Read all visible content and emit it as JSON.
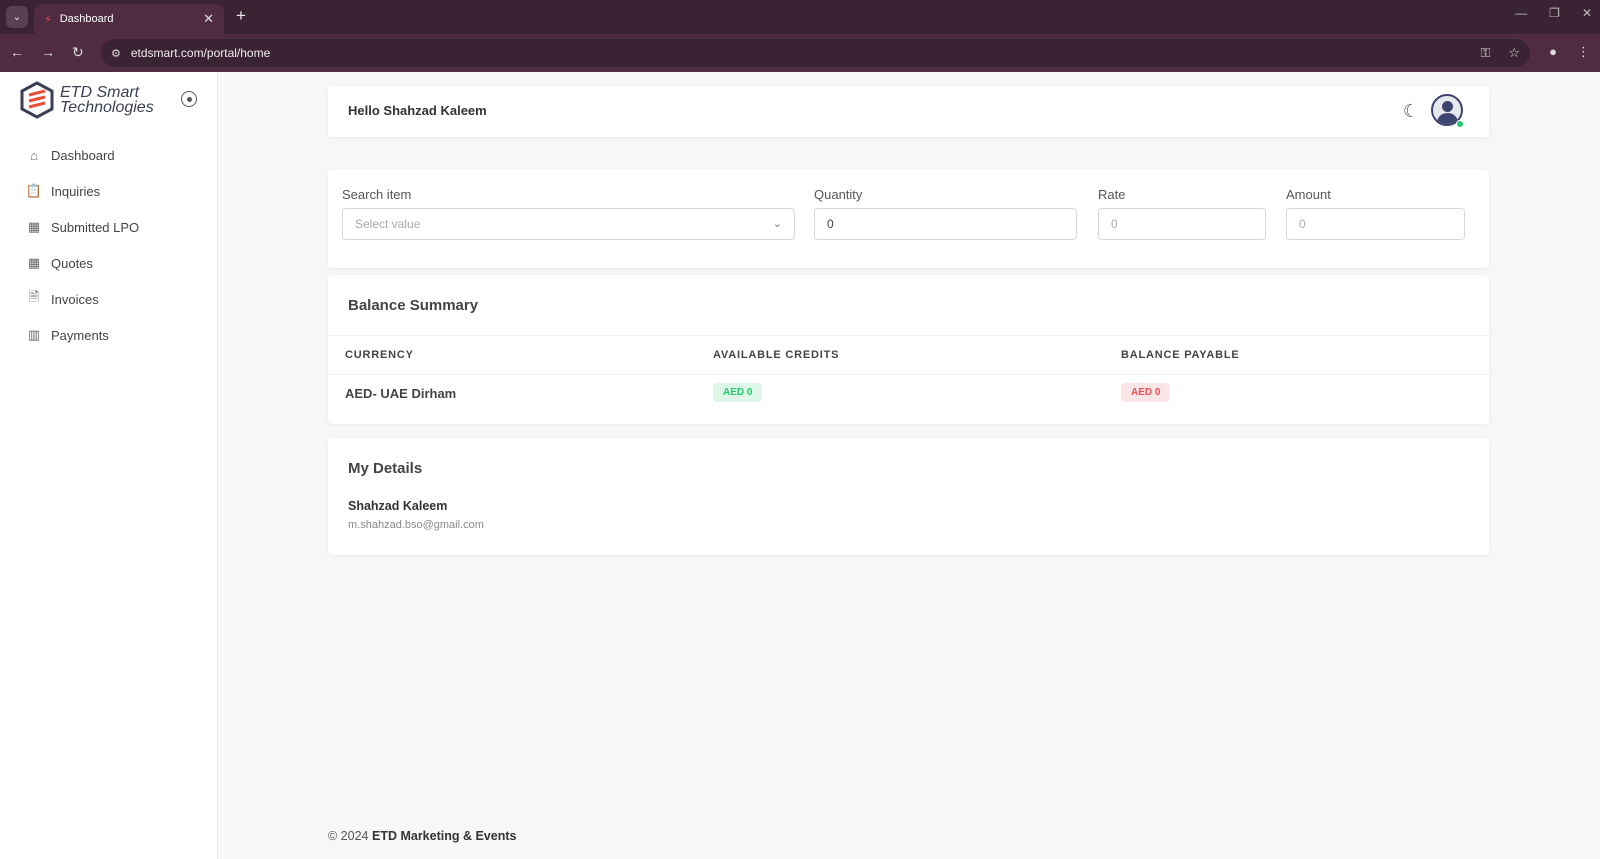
{
  "browser": {
    "tab_title": "Dashboard",
    "url": "etdsmart.com/portal/home"
  },
  "sidebar": {
    "logo_line1": "ETD Smart",
    "logo_line2": "Technologies",
    "items": [
      {
        "label": "Dashboard",
        "icon": "home-icon"
      },
      {
        "label": "Inquiries",
        "icon": "clipboard-search-icon"
      },
      {
        "label": "Submitted LPO",
        "icon": "calendar-icon"
      },
      {
        "label": "Quotes",
        "icon": "calendar-icon"
      },
      {
        "label": "Invoices",
        "icon": "invoice-icon"
      },
      {
        "label": "Payments",
        "icon": "payments-icon"
      }
    ]
  },
  "header": {
    "greeting": "Hello Shahzad Kaleem"
  },
  "search": {
    "item_label": "Search item",
    "item_placeholder": "Select value",
    "quantity_label": "Quantity",
    "quantity_value": "0",
    "rate_label": "Rate",
    "rate_value": "0",
    "amount_label": "Amount",
    "amount_value": "0"
  },
  "balance": {
    "title": "Balance Summary",
    "columns": [
      "CURRENCY",
      "AVAILABLE CREDITS",
      "BALANCE PAYABLE"
    ],
    "rows": [
      {
        "currency": "AED- UAE Dirham",
        "credits": "AED 0",
        "payable": "AED 0"
      }
    ],
    "colors": {
      "credits": "#28c76f",
      "payable": "#ea5455"
    }
  },
  "details": {
    "title": "My Details",
    "name": "Shahzad Kaleem",
    "email": "m.shahzad.bso@gmail.com"
  },
  "footer": {
    "prefix": "© 2024",
    "company": "ETD Marketing & Events"
  }
}
